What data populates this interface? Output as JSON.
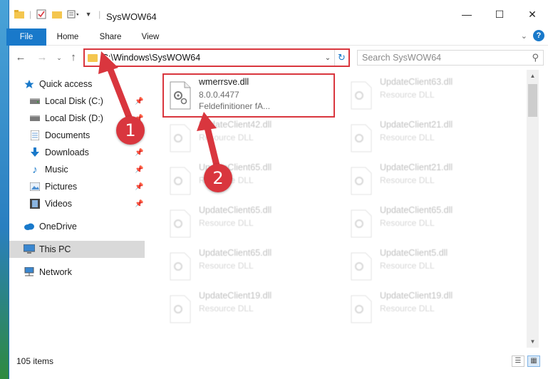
{
  "window": {
    "title": "SysWOW64"
  },
  "ribbon": {
    "tabs": [
      "File",
      "Home",
      "Share",
      "View"
    ]
  },
  "address": {
    "path": "C:\\Windows\\SysWOW64"
  },
  "search": {
    "placeholder": "Search SysWOW64"
  },
  "sidebar": {
    "items": [
      {
        "label": "Quick access",
        "icon": "star-icon",
        "pinned": false
      },
      {
        "label": "Local Disk (C:)",
        "icon": "drive-icon",
        "pinned": true
      },
      {
        "label": "Local Disk (D:)",
        "icon": "drive-icon",
        "pinned": true
      },
      {
        "label": "Documents",
        "icon": "documents-icon",
        "pinned": true
      },
      {
        "label": "Downloads",
        "icon": "download-icon",
        "pinned": true
      },
      {
        "label": "Music",
        "icon": "music-icon",
        "pinned": true
      },
      {
        "label": "Pictures",
        "icon": "pictures-icon",
        "pinned": true
      },
      {
        "label": "Videos",
        "icon": "videos-icon",
        "pinned": true
      },
      {
        "label": "OneDrive",
        "icon": "cloud-icon",
        "pinned": false
      },
      {
        "label": "This PC",
        "icon": "computer-icon",
        "pinned": false,
        "selected": true
      },
      {
        "label": "Network",
        "icon": "network-icon",
        "pinned": false
      }
    ]
  },
  "files": [
    {
      "name": "wmerrsve.dll",
      "line2": "8.0.0.4477",
      "line3": "Feldefinitioner fA...",
      "highlighted": true
    },
    {
      "name": "UpdateClient63.dll",
      "line2": "Resource DLL"
    },
    {
      "name": "UpdateClient42.dll",
      "line2": "Resource DLL"
    },
    {
      "name": "UpdateClient21.dll",
      "line2": "Resource DLL"
    },
    {
      "name": "UpdateClient65.dll",
      "line2": "Resource DLL"
    },
    {
      "name": "UpdateClient21.dll",
      "line2": "Resource DLL"
    },
    {
      "name": "UpdateClient65.dll",
      "line2": "Resource DLL"
    },
    {
      "name": "UpdateClient65.dll",
      "line2": "Resource DLL"
    },
    {
      "name": "UpdateClient65.dll",
      "line2": "Resource DLL"
    },
    {
      "name": "UpdateClient5.dll",
      "line2": "Resource DLL"
    },
    {
      "name": "UpdateClient19.dll",
      "line2": "Resource DLL"
    },
    {
      "name": "UpdateClient19.dll",
      "line2": "Resource DLL"
    }
  ],
  "status": {
    "item_count": "105 items"
  },
  "callouts": [
    "1",
    "2"
  ],
  "colors": {
    "accent": "#1979ca",
    "highlight": "#d9363e"
  }
}
